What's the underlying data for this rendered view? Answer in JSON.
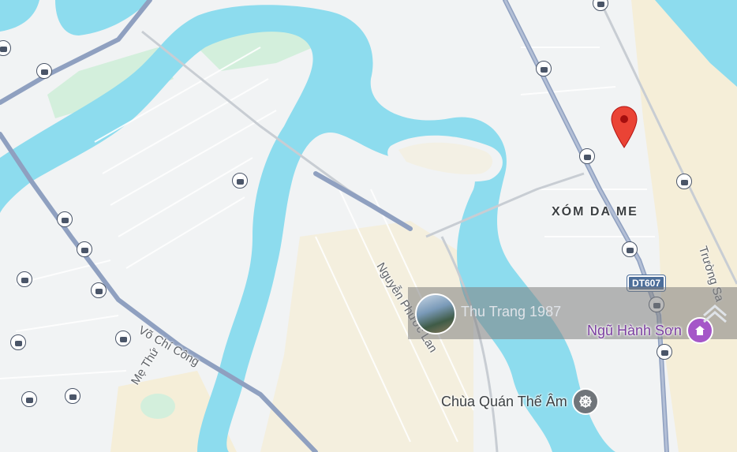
{
  "map": {
    "colors": {
      "water": "#8ddcee",
      "land": "#f1f3f4",
      "sand": "#f5eed8",
      "park": "#d3efdc",
      "major_road": "#8fa0c0",
      "road": "#ffffff"
    },
    "labels": {
      "street_nguyen_phuoc_lan": "Nguyễn Phước Lan",
      "street_vo_chi_cong": "Võ Chí Công",
      "street_me_thu": "Mẹ Thứ",
      "street_truong_sa": "Trường Sa",
      "area_xom_da_me": "XÓM DA ME",
      "route_dt607": "DT607",
      "poi_chua_quan_the_am": "Chùa Quán Thế Âm",
      "district_ngu_hanh_son": "Ngũ Hành Sơn"
    },
    "photo_card": {
      "name": "Thu Trang 1987"
    },
    "bus_stop_count": 19
  }
}
